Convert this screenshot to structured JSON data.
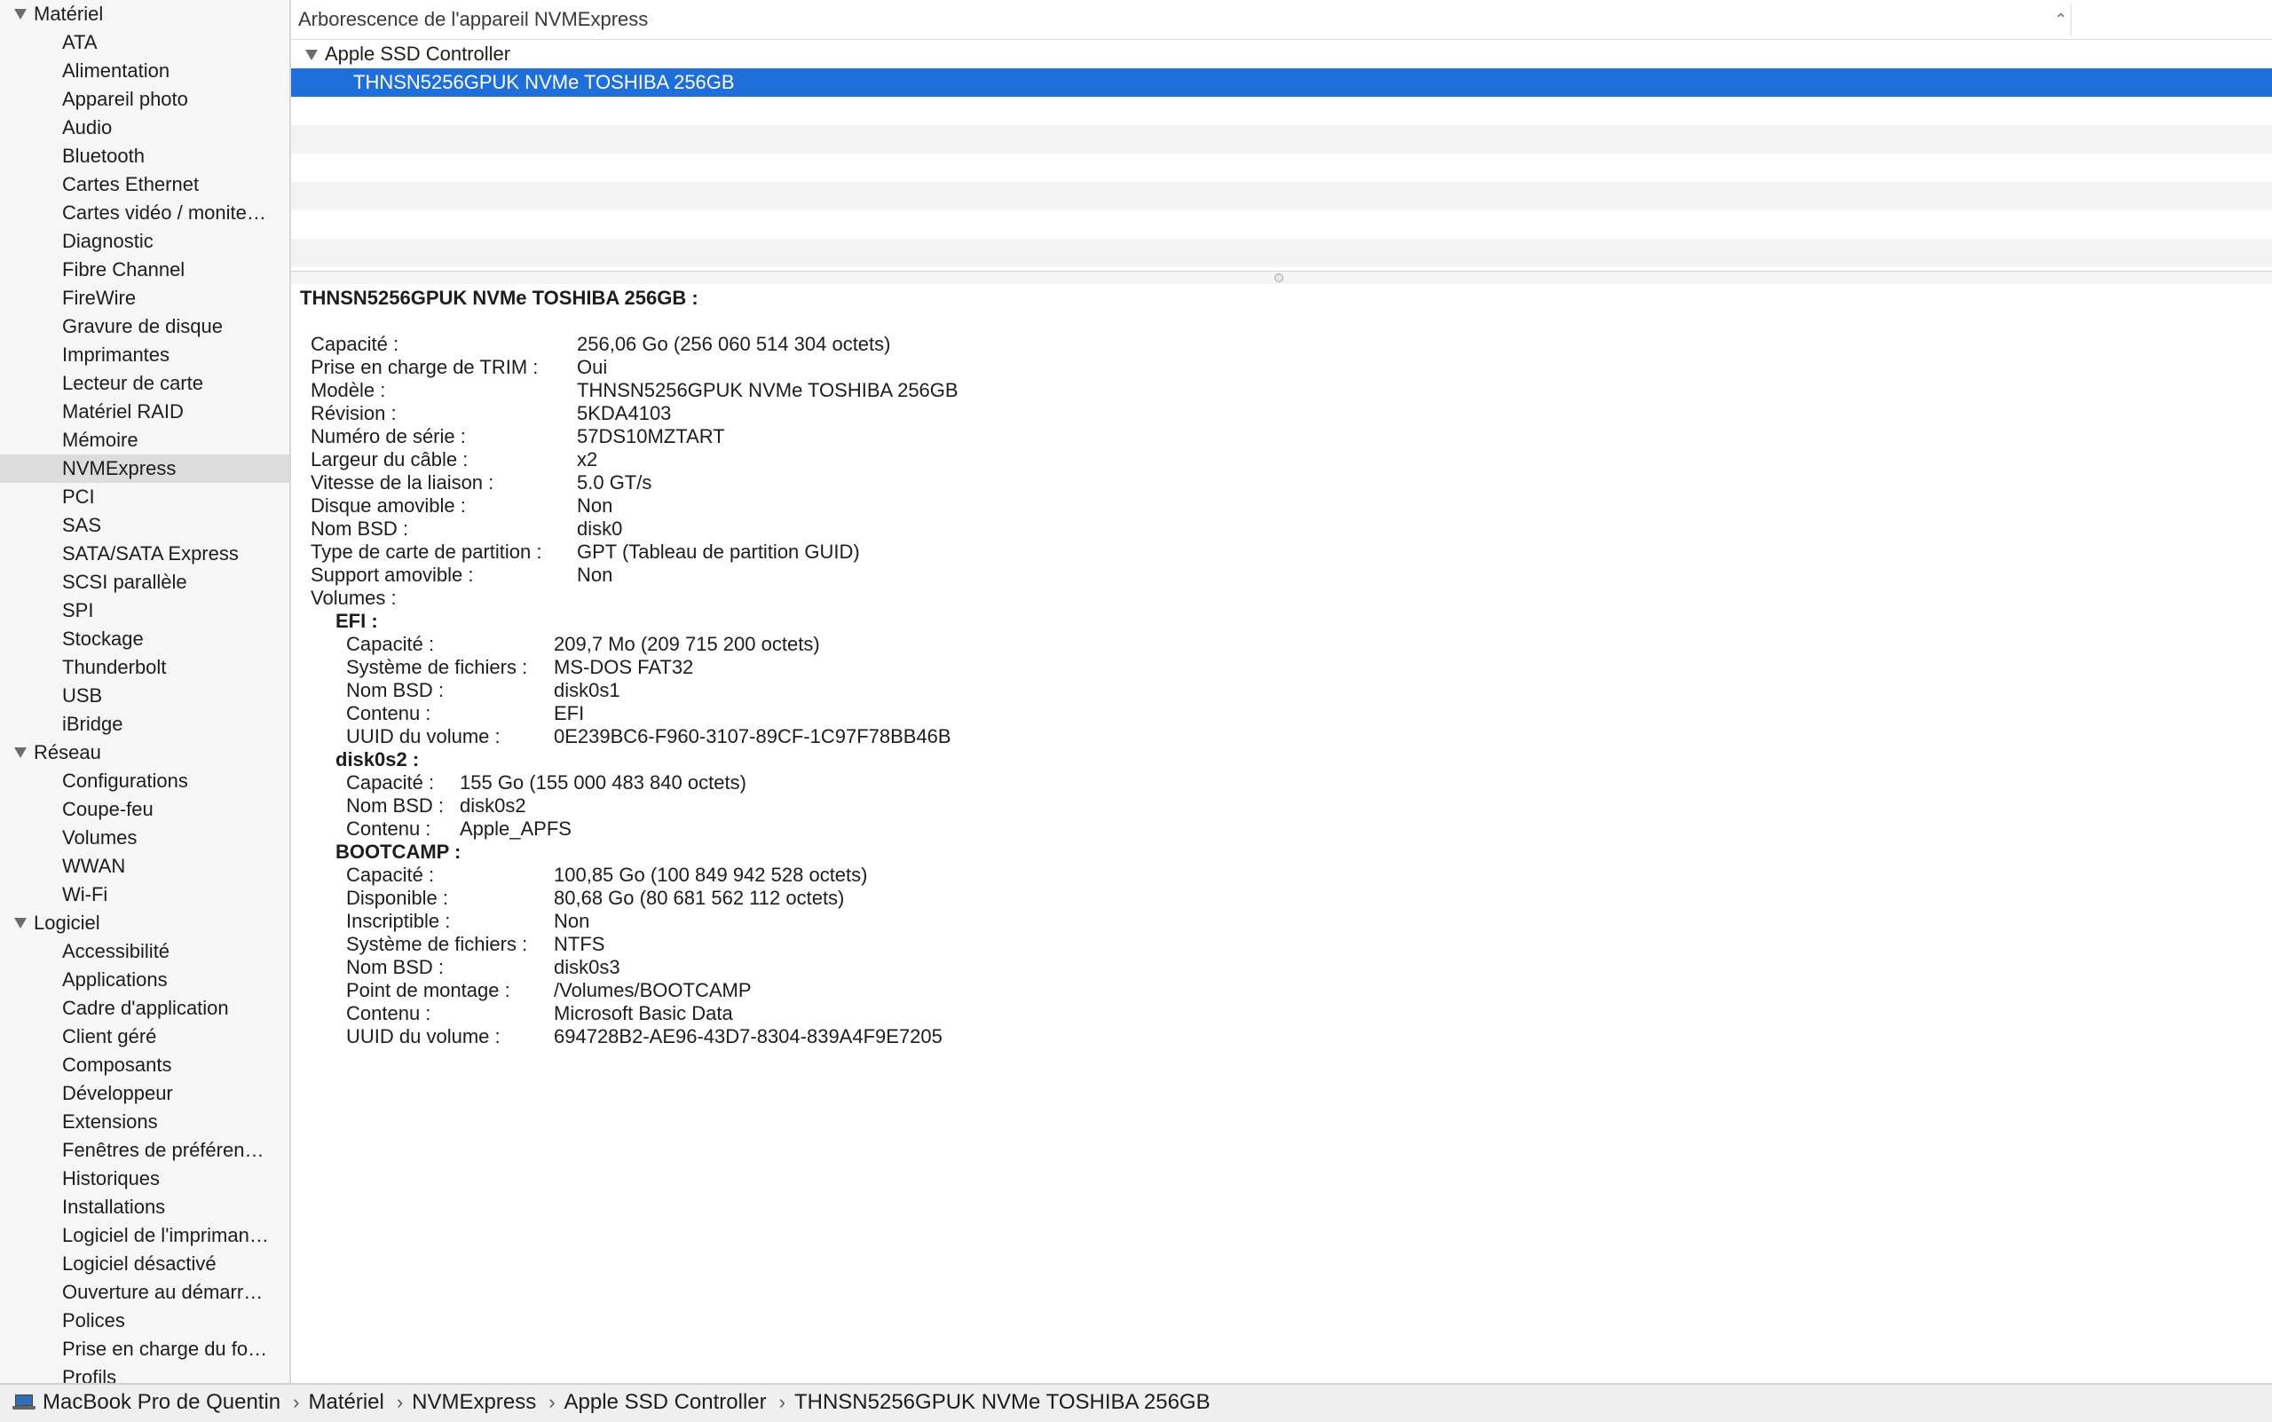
{
  "sidebar": {
    "categories": [
      {
        "label": "Matériel",
        "items": [
          "ATA",
          "Alimentation",
          "Appareil photo",
          "Audio",
          "Bluetooth",
          "Cartes Ethernet",
          "Cartes vidéo / monite…",
          "Diagnostic",
          "Fibre Channel",
          "FireWire",
          "Gravure de disque",
          "Imprimantes",
          "Lecteur de carte",
          "Matériel RAID",
          "Mémoire",
          "NVMExpress",
          "PCI",
          "SAS",
          "SATA/SATA Express",
          "SCSI parallèle",
          "SPI",
          "Stockage",
          "Thunderbolt",
          "USB",
          "iBridge"
        ]
      },
      {
        "label": "Réseau",
        "items": [
          "Configurations",
          "Coupe-feu",
          "Volumes",
          "WWAN",
          "Wi-Fi"
        ]
      },
      {
        "label": "Logiciel",
        "items": [
          "Accessibilité",
          "Applications",
          "Cadre d'application",
          "Client géré",
          "Composants",
          "Développeur",
          "Extensions",
          "Fenêtres de préféren…",
          "Historiques",
          "Installations",
          "Logiciel de l'impriman…",
          "Logiciel désactivé",
          "Ouverture au démarr…",
          "Polices",
          "Prise en charge du fo…",
          "Profils"
        ]
      }
    ],
    "selected": "NVMExpress"
  },
  "tree": {
    "header": "Arborescence de l'appareil NVMExpress",
    "controller": "Apple SSD Controller",
    "device": "THNSN5256GPUK NVMe TOSHIBA 256GB"
  },
  "detail": {
    "title": "THNSN5256GPUK NVMe TOSHIBA 256GB :",
    "fields": [
      {
        "k": "Capacité :",
        "v": "256,06 Go (256 060 514 304 octets)"
      },
      {
        "k": "Prise en charge de TRIM :",
        "v": "Oui"
      },
      {
        "k": "Modèle :",
        "v": "THNSN5256GPUK NVMe TOSHIBA 256GB"
      },
      {
        "k": "Révision :",
        "v": "5KDA4103"
      },
      {
        "k": "Numéro de série :",
        "v": "57DS10MZTART"
      },
      {
        "k": "Largeur du câble :",
        "v": "x2"
      },
      {
        "k": "Vitesse de la liaison :",
        "v": "5.0 GT/s"
      },
      {
        "k": "Disque amovible :",
        "v": "Non"
      },
      {
        "k": "Nom BSD :",
        "v": "disk0"
      },
      {
        "k": "Type de carte de partition :",
        "v": "GPT (Tableau de partition GUID)"
      },
      {
        "k": "Support amovible :",
        "v": "Non"
      },
      {
        "k": "Volumes :",
        "v": ""
      }
    ],
    "volumes": [
      {
        "name": "EFI :",
        "fields": [
          {
            "k": "Capacité :",
            "v": "209,7 Mo (209 715 200 octets)"
          },
          {
            "k": "Système de fichiers :",
            "v": "MS-DOS FAT32"
          },
          {
            "k": "Nom BSD :",
            "v": "disk0s1"
          },
          {
            "k": "Contenu :",
            "v": "EFI"
          },
          {
            "k": "UUID du volume :",
            "v": "0E239BC6-F960-3107-89CF-1C97F78BB46B"
          }
        ]
      },
      {
        "name": "disk0s2 :",
        "fields": [
          {
            "k": "Capacité :",
            "v": "155 Go (155 000 483 840 octets)"
          },
          {
            "k": "Nom BSD :",
            "v": "disk0s2"
          },
          {
            "k": "Contenu :",
            "v": "Apple_APFS"
          }
        ]
      },
      {
        "name": "BOOTCAMP :",
        "fields": [
          {
            "k": "Capacité :",
            "v": "100,85 Go (100 849 942 528 octets)"
          },
          {
            "k": "Disponible :",
            "v": "80,68 Go (80 681 562 112 octets)"
          },
          {
            "k": "Inscriptible :",
            "v": "Non"
          },
          {
            "k": "Système de fichiers :",
            "v": "NTFS"
          },
          {
            "k": "Nom BSD :",
            "v": "disk0s3"
          },
          {
            "k": "Point de montage :",
            "v": "/Volumes/BOOTCAMP"
          },
          {
            "k": "Contenu :",
            "v": "Microsoft Basic Data"
          },
          {
            "k": "UUID du volume :",
            "v": "694728B2-AE96-43D7-8304-839A4F9E7205"
          }
        ]
      }
    ]
  },
  "statusbar": {
    "crumbs": [
      "MacBook Pro de Quentin",
      "Matériel",
      "NVMExpress",
      "Apple SSD Controller",
      "THNSN5256GPUK NVMe TOSHIBA 256GB"
    ],
    "separator": "›",
    "icon": "laptop-icon"
  },
  "colors": {
    "selection": "#1e6fd9",
    "sidebar_selection": "#dcdcdc"
  }
}
